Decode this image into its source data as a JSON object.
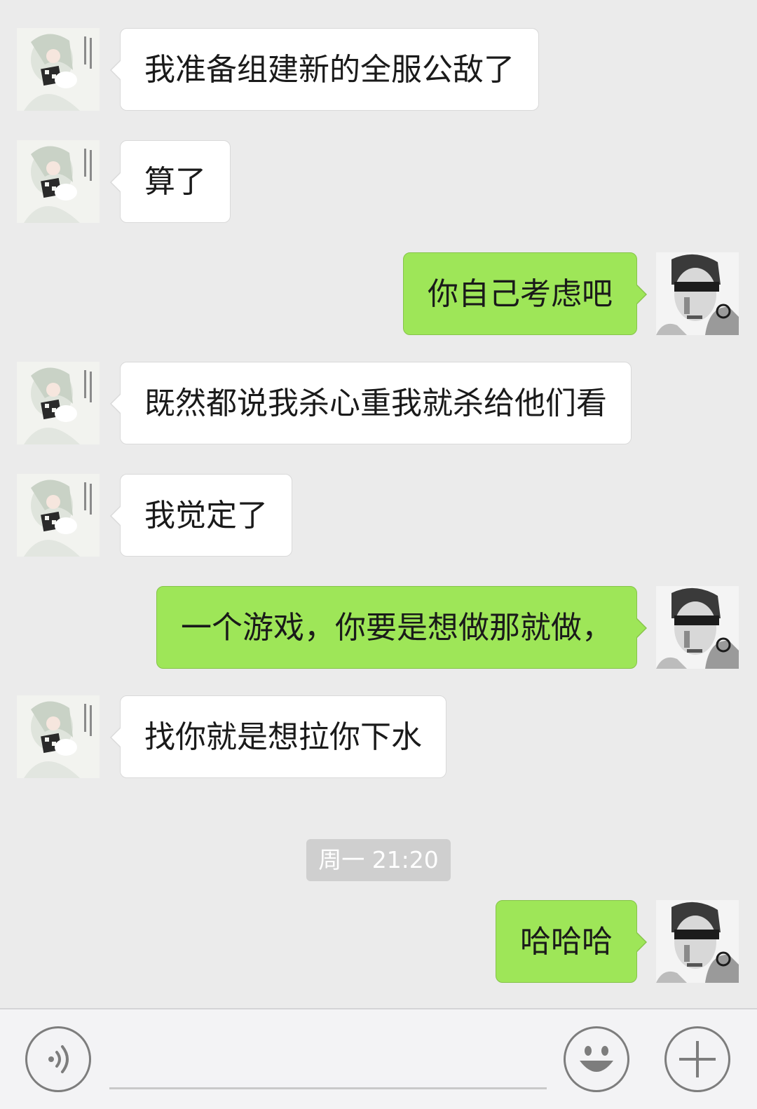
{
  "messages": [
    {
      "side": "in",
      "text": "我准备组建新的全服公敌了"
    },
    {
      "side": "in",
      "text": "算了"
    },
    {
      "side": "out",
      "text": "你自己考虑吧"
    },
    {
      "side": "in",
      "text": "既然都说我杀心重我就杀给他们看"
    },
    {
      "side": "in",
      "text": "我觉定了"
    },
    {
      "side": "out",
      "text": "一个游戏，你要是想做那就做，"
    },
    {
      "side": "in",
      "text": "找你就是想拉你下水"
    },
    {
      "side": "out",
      "text": "哈哈哈"
    }
  ],
  "timestamp": "周一 21:20",
  "input_bar": {
    "voice_icon": "voice-icon",
    "emoji_icon": "emoji-icon",
    "plus_icon": "plus-icon",
    "text_value": ""
  },
  "colors": {
    "background": "#ebebeb",
    "incoming_bubble": "#ffffff",
    "outgoing_bubble": "#9ee658",
    "timestamp_bg": "#cfcfcf"
  }
}
